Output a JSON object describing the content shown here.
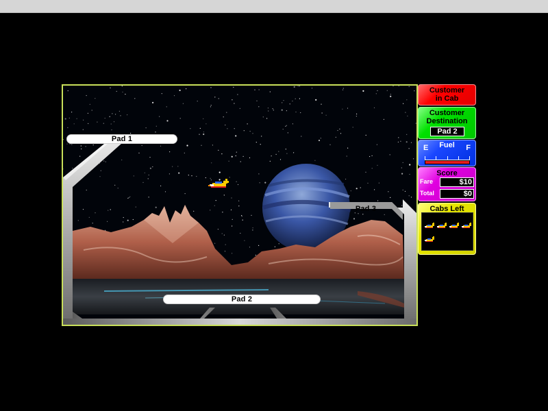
{
  "pads": [
    {
      "label": "Pad 1"
    },
    {
      "label": "Pad 2"
    },
    {
      "label": "Pad 3"
    }
  ],
  "panels": {
    "customer_in_cab": {
      "line1": "Customer",
      "line2": "in Cab",
      "color": "#ff0000"
    },
    "customer_destination": {
      "line1": "Customer",
      "line2": "Destination",
      "value": "Pad 2",
      "color": "#00dd00"
    },
    "fuel": {
      "title": "Fuel",
      "empty_label": "E",
      "full_label": "F",
      "level": 1.0,
      "color": "#1a47ff",
      "bar_color": "#e51d1d"
    },
    "score": {
      "title": "Score",
      "fare_label": "Fare",
      "fare_value": "$10",
      "total_label": "Total",
      "total_value": "$0",
      "color": "#e000e0"
    },
    "cabs_left": {
      "title": "Cabs Left",
      "count": 5,
      "color": "#e6e600"
    }
  },
  "icons": {
    "player_cab": "taxi-ship-icon",
    "mini_cab": "spare-taxi-icon"
  },
  "colors": {
    "viewport_border": "#c9e05a",
    "background": "#000000"
  }
}
